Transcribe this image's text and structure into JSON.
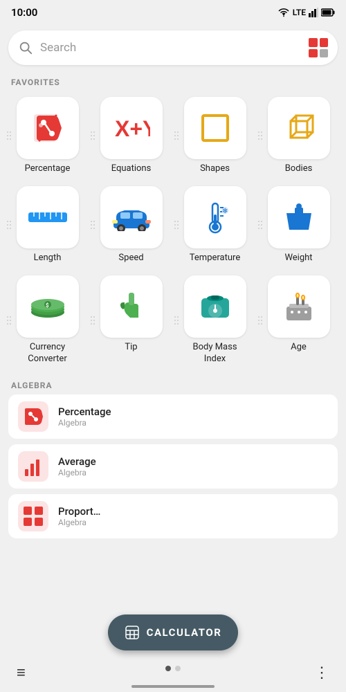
{
  "statusBar": {
    "time": "10:00",
    "lte": "LTE"
  },
  "searchBar": {
    "placeholder": "Search"
  },
  "sections": {
    "favorites": "FAVORITES",
    "algebra": "ALGEBRA"
  },
  "favoriteItems": [
    {
      "id": "percentage",
      "label": "Percentage",
      "iconType": "percentage"
    },
    {
      "id": "equations",
      "label": "Equations",
      "iconType": "equations"
    },
    {
      "id": "shapes",
      "label": "Shapes",
      "iconType": "shapes"
    },
    {
      "id": "bodies",
      "label": "Bodies",
      "iconType": "bodies"
    },
    {
      "id": "length",
      "label": "Length",
      "iconType": "length"
    },
    {
      "id": "speed",
      "label": "Speed",
      "iconType": "speed"
    },
    {
      "id": "temperature",
      "label": "Temperature",
      "iconType": "temperature"
    },
    {
      "id": "weight",
      "label": "Weight",
      "iconType": "weight"
    },
    {
      "id": "currency",
      "label": "Currency\nConverter",
      "iconType": "currency"
    },
    {
      "id": "tip",
      "label": "Tip",
      "iconType": "tip"
    },
    {
      "id": "bmi",
      "label": "Body Mass\nIndex",
      "iconType": "bmi"
    },
    {
      "id": "age",
      "label": "Age",
      "iconType": "age"
    }
  ],
  "algebraItems": [
    {
      "id": "percentage-list",
      "title": "Percentage",
      "subtitle": "Algebra",
      "iconType": "percentage"
    },
    {
      "id": "average-list",
      "title": "Average",
      "subtitle": "Algebra",
      "iconType": "average"
    },
    {
      "id": "proportion-list",
      "title": "Proport…",
      "subtitle": "Algebra",
      "iconType": "proportion"
    }
  ],
  "fab": {
    "label": "CALCULATOR"
  },
  "bottomNav": {
    "menuIcon": "≡",
    "dotsIcon": "⋮"
  }
}
